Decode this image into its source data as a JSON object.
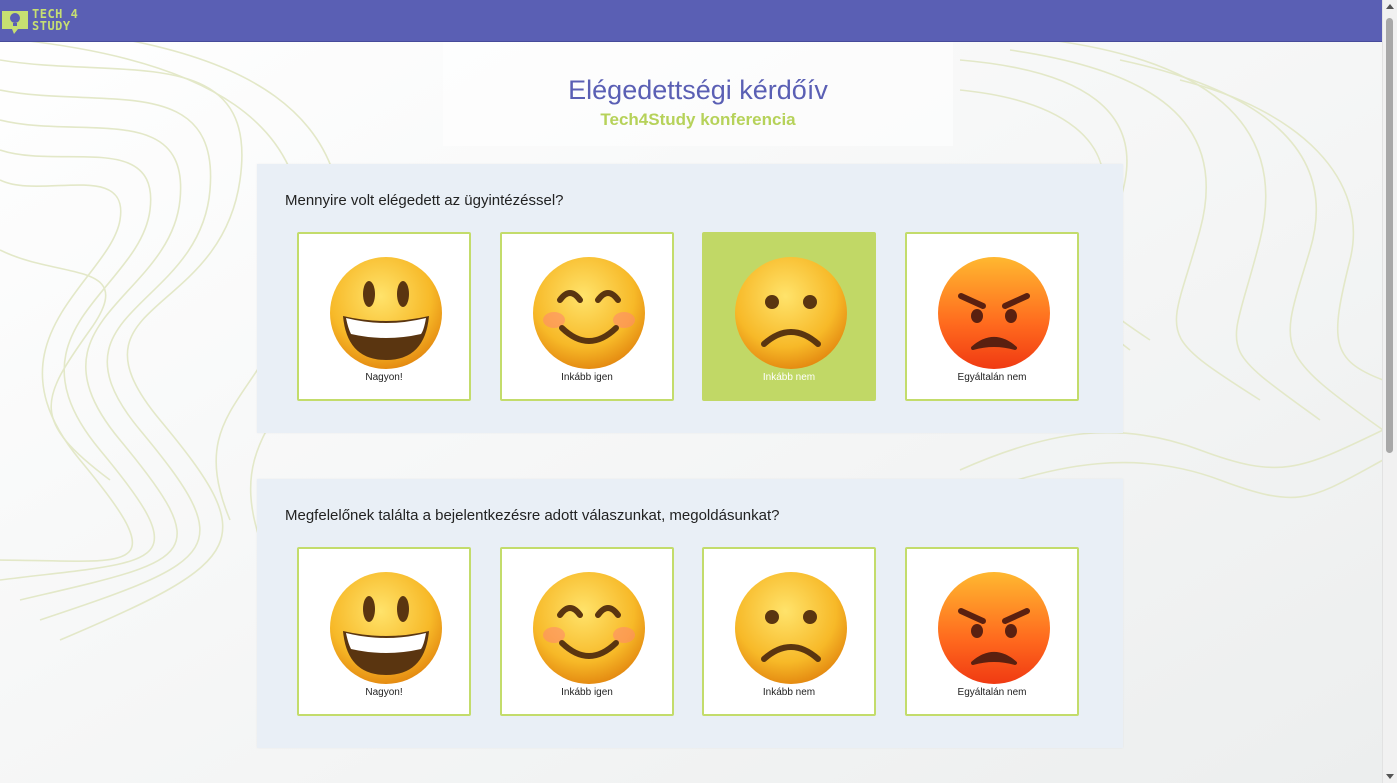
{
  "brand": {
    "logo_line1": "TECH 4",
    "logo_line2": "STUDY"
  },
  "header": {
    "title": "Elégedettségi kérdőív",
    "subtitle": "Tech4Study konferencia"
  },
  "questions": [
    {
      "text": "Mennyire volt elégedett az ügyintézéssel?",
      "options": [
        {
          "label": "Nagyon!",
          "icon": "grinning-face-icon",
          "selected": false
        },
        {
          "label": "Inkább igen",
          "icon": "smiling-face-icon",
          "selected": false
        },
        {
          "label": "Inkább nem",
          "icon": "frowning-face-icon",
          "selected": true
        },
        {
          "label": "Egyáltalán nem",
          "icon": "angry-face-icon",
          "selected": false
        }
      ]
    },
    {
      "text": "Megfelelőnek találta a bejelentkezésre adott válaszunkat, megoldásunkat?",
      "options": [
        {
          "label": "Nagyon!",
          "icon": "grinning-face-icon",
          "selected": false
        },
        {
          "label": "Inkább igen",
          "icon": "smiling-face-icon",
          "selected": false
        },
        {
          "label": "Inkább nem",
          "icon": "frowning-face-icon",
          "selected": false
        },
        {
          "label": "Egyáltalán nem",
          "icon": "angry-face-icon",
          "selected": false
        }
      ]
    }
  ],
  "colors": {
    "topbar": "#5a5fb4",
    "accent_green": "#c1d866",
    "title_blue": "#5a5fb4",
    "question_bg": "#e9eff6"
  }
}
